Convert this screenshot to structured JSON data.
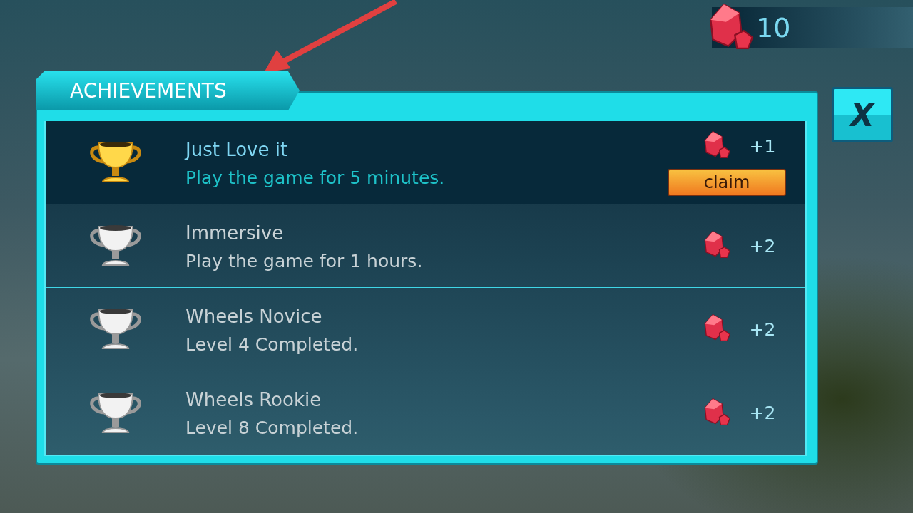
{
  "currency": {
    "amount": "10"
  },
  "panel": {
    "title": "ACHIEVEMENTS"
  },
  "close_button": {
    "label": "X"
  },
  "achievements": [
    {
      "title": "Just Love it",
      "description": "Play the game for 5 minutes.",
      "reward": "+1",
      "unlocked": true,
      "claim_label": "claim"
    },
    {
      "title": "Immersive",
      "description": "Play the game for 1 hours.",
      "reward": "+2",
      "unlocked": false
    },
    {
      "title": "Wheels Novice",
      "description": "Level 4 Completed.",
      "reward": "+2",
      "unlocked": false
    },
    {
      "title": "Wheels Rookie",
      "description": "Level 8 Completed.",
      "reward": "+2",
      "unlocked": false
    }
  ]
}
